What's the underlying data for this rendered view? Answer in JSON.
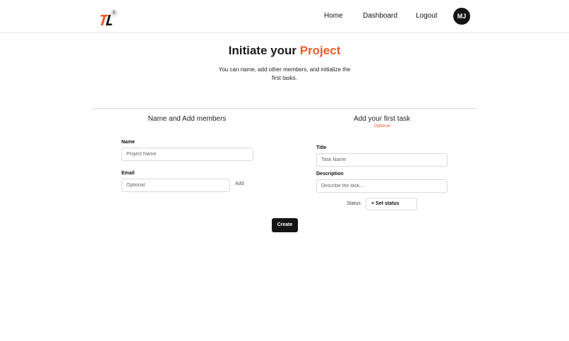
{
  "header": {
    "logo_badge": "0",
    "nav": {
      "home": "Home",
      "dashboard": "Dashboard",
      "logout": "Logout"
    },
    "avatar_initials": "MJ"
  },
  "hero": {
    "title_prefix": "Initiate your",
    "title_accent": "Project",
    "subtitle": "You can name, add other members, and initialize the first tasks."
  },
  "left_section": {
    "title": "Name and Add members",
    "name_label": "Name",
    "name_placeholder": "Project Name",
    "email_label": "Email",
    "email_placeholder": "Optional",
    "add_label": "Add"
  },
  "right_section": {
    "title": "Add your first task",
    "optional_tag": "Optional",
    "title_label": "Title",
    "title_placeholder": "Task Name",
    "description_label": "Description",
    "description_placeholder": "Describe the task...",
    "status_label": "Status",
    "status_button": "+ Set status"
  },
  "actions": {
    "create": "Create"
  },
  "colors": {
    "accent": "#f05a28",
    "dark": "#141414"
  }
}
